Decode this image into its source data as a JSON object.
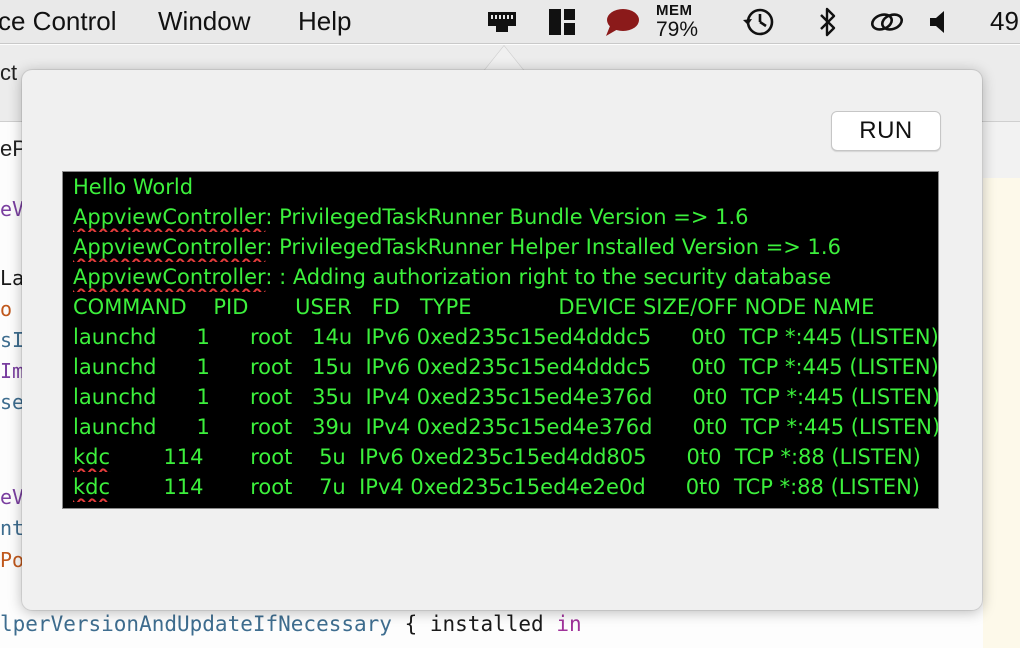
{
  "menubar": {
    "items": [
      "ce Control",
      "Window",
      "Help"
    ],
    "mem_label": "MEM",
    "mem_value": "79%",
    "clock": "49"
  },
  "icons": {
    "network": "ethernet-icon",
    "layout": "grid-layout-icon",
    "chat": "speech-bubble-icon",
    "history": "time-machine-icon",
    "bluetooth": "bluetooth-icon",
    "link": "link-icon",
    "volume": "speaker-icon"
  },
  "editor": {
    "tab1": "ct",
    "tab2": "eP",
    "code_fragments": [
      {
        "text": "eVi",
        "color": "#7a3fa0"
      },
      {
        "text": "Lau",
        "color": "#1a1a1a"
      },
      {
        "text": "o i",
        "color": "#c0581c"
      },
      {
        "text": "sIt",
        "color": "#3e6d8f"
      },
      {
        "text": "Ima",
        "color": "#7a3fa0"
      },
      {
        "text": "sel",
        "color": "#3e6d8f"
      },
      {
        "text": "eVi",
        "color": "#7a3fa0"
      },
      {
        "text": "nti",
        "color": "#3e6d8f"
      },
      {
        "text": "Pop",
        "color": "#c0581c"
      }
    ],
    "bottom_fn": "lperVersionAndUpdateIfNecessary",
    "bottom_rest": " { installed ",
    "bottom_kw": "in"
  },
  "popover": {
    "run_label": "RUN",
    "console_lines": [
      {
        "prefix": "",
        "text": "Hello World"
      },
      {
        "prefix": "AppviewController",
        "text": ": PrivilegedTaskRunner Bundle Version => 1.6"
      },
      {
        "prefix": "AppviewController",
        "text": ": PrivilegedTaskRunner Helper Installed Version => 1.6"
      },
      {
        "prefix": "AppviewController",
        "text": ": : Adding authorization right to the security database"
      },
      {
        "prefix": "",
        "text": "COMMAND    PID       USER   FD   TYPE             DEVICE SIZE/OFF NODE NAME"
      },
      {
        "prefix": "",
        "text": "launchd      1      root   14u  IPv6 0xed235c15ed4dddc5      0t0  TCP *:445 (LISTEN)"
      },
      {
        "prefix": "",
        "text": "launchd      1      root   15u  IPv6 0xed235c15ed4dddc5      0t0  TCP *:445 (LISTEN)"
      },
      {
        "prefix": "",
        "text": "launchd      1      root   35u  IPv4 0xed235c15ed4e376d      0t0  TCP *:445 (LISTEN)"
      },
      {
        "prefix": "",
        "text": "launchd      1      root   39u  IPv4 0xed235c15ed4e376d      0t0  TCP *:445 (LISTEN)"
      },
      {
        "prefix": "kdc",
        "text": "        114       root    5u  IPv6 0xed235c15ed4dd805      0t0  TCP *:88 (LISTEN)"
      },
      {
        "prefix": "kdc",
        "text": "        114       root    7u  IPv4 0xed235c15ed4e2e0d      0t0  TCP *:88 (LISTEN)"
      }
    ]
  }
}
